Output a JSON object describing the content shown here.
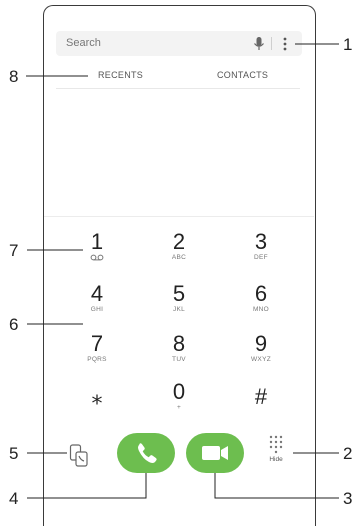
{
  "search": {
    "placeholder": "Search",
    "mic_icon": "mic-icon",
    "menu_icon": "more-vert-icon"
  },
  "tabs": [
    {
      "label": "RECENTS"
    },
    {
      "label": "CONTACTS"
    }
  ],
  "keypad": [
    {
      "digit": "1",
      "letters": "",
      "icon": "voicemail-icon"
    },
    {
      "digit": "2",
      "letters": "ABC"
    },
    {
      "digit": "3",
      "letters": "DEF"
    },
    {
      "digit": "4",
      "letters": "GHI"
    },
    {
      "digit": "5",
      "letters": "JKL"
    },
    {
      "digit": "6",
      "letters": "MNO"
    },
    {
      "digit": "7",
      "letters": "PQRS"
    },
    {
      "digit": "8",
      "letters": "TUV"
    },
    {
      "digit": "9",
      "letters": "WXYZ"
    },
    {
      "digit": "⁎",
      "letters": ""
    },
    {
      "digit": "0",
      "letters": "+"
    },
    {
      "digit": "#",
      "letters": ""
    }
  ],
  "actions": {
    "hide_label": "Hide",
    "colors": {
      "call": "#6dbe4f"
    }
  },
  "callouts": [
    "1",
    "2",
    "3",
    "4",
    "5",
    "6",
    "7",
    "8"
  ]
}
